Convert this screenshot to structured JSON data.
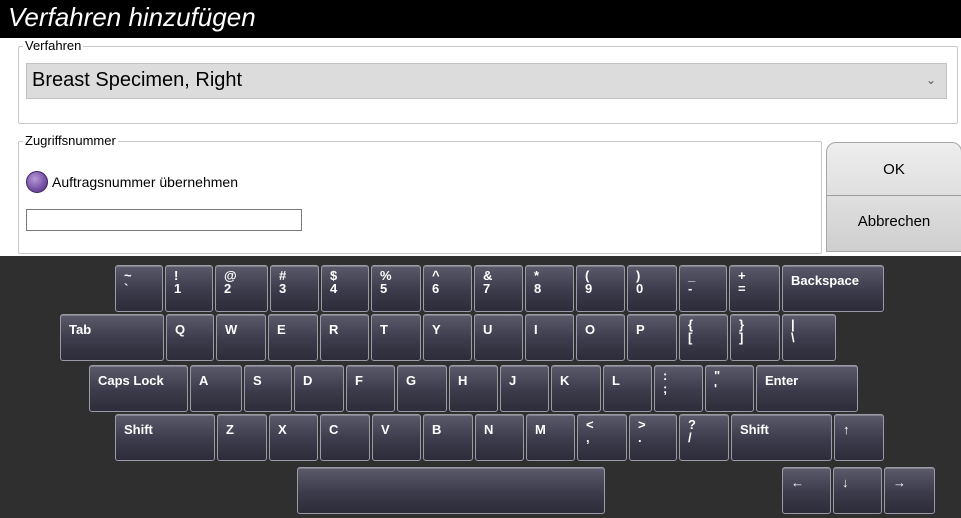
{
  "dialog": {
    "title": "Verfahren hinzufügen"
  },
  "verfahren": {
    "label": "Verfahren",
    "selected": "Breast Specimen, Right",
    "chevron": "⌄"
  },
  "zugriff": {
    "label": "Zugriffsnummer",
    "radio_label": "Auftragsnummer übernehmen",
    "input_value": ""
  },
  "buttons": {
    "ok": "OK",
    "cancel": "Abbrechen"
  },
  "keyboard": {
    "row1": [
      {
        "top": "~",
        "bot": "`"
      },
      {
        "top": "!",
        "bot": "1"
      },
      {
        "top": "@",
        "bot": "2"
      },
      {
        "top": "#",
        "bot": "3"
      },
      {
        "top": "$",
        "bot": "4"
      },
      {
        "top": "%",
        "bot": "5"
      },
      {
        "top": "^",
        "bot": "6"
      },
      {
        "top": "&",
        "bot": "7"
      },
      {
        "top": "*",
        "bot": "8"
      },
      {
        "top": "(",
        "bot": "9"
      },
      {
        "top": ")",
        "bot": "0"
      },
      {
        "top": "_",
        "bot": "-"
      },
      {
        "top": "+",
        "bot": "="
      },
      {
        "one": "Backspace"
      }
    ],
    "row2": [
      {
        "one": "Tab"
      },
      {
        "one": "Q"
      },
      {
        "one": "W"
      },
      {
        "one": "E"
      },
      {
        "one": "R"
      },
      {
        "one": "T"
      },
      {
        "one": "Y"
      },
      {
        "one": "U"
      },
      {
        "one": "I"
      },
      {
        "one": "O"
      },
      {
        "one": "P"
      },
      {
        "top": "{",
        "bot": "["
      },
      {
        "top": "}",
        "bot": "]"
      },
      {
        "top": "|",
        "bot": "\\"
      }
    ],
    "row3": [
      {
        "one": "Caps Lock"
      },
      {
        "one": "A"
      },
      {
        "one": "S"
      },
      {
        "one": "D"
      },
      {
        "one": "F"
      },
      {
        "one": "G"
      },
      {
        "one": "H"
      },
      {
        "one": "J"
      },
      {
        "one": "K"
      },
      {
        "one": "L"
      },
      {
        "top": ":",
        "bot": ";"
      },
      {
        "top": "\"",
        "bot": "'"
      },
      {
        "one": "Enter"
      }
    ],
    "row4": [
      {
        "one": "Shift"
      },
      {
        "one": "Z"
      },
      {
        "one": "X"
      },
      {
        "one": "C"
      },
      {
        "one": "V"
      },
      {
        "one": "B"
      },
      {
        "one": "N"
      },
      {
        "one": "M"
      },
      {
        "top": "<",
        "bot": ","
      },
      {
        "top": ">",
        "bot": "."
      },
      {
        "top": "?",
        "bot": "/"
      },
      {
        "one": "Shift"
      },
      {
        "one": "↑"
      }
    ],
    "row5": [
      {
        "one": ""
      },
      {
        "one": "←"
      },
      {
        "one": "↓"
      },
      {
        "one": "→"
      }
    ]
  }
}
